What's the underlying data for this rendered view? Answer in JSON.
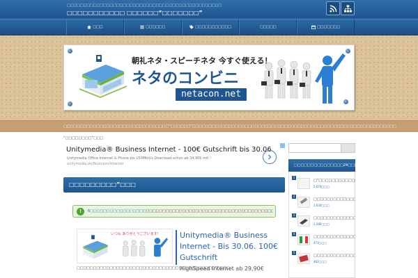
{
  "header": {
    "tagline": "□□□□□□□□□□□□□□□□□□□□□□□□□□□□□□□□□□□□□□□□□□□□□□□",
    "site_title": "□□□□□□□□□□□ □□□□□□“□□□□□□□”",
    "buttons": [
      {
        "name": "rss-icon"
      },
      {
        "name": "sitemap-icon"
      }
    ]
  },
  "nav": {
    "items": [
      {
        "icon": "home-icon",
        "label": "□□□"
      },
      {
        "icon": "list-icon",
        "label": "□□□□□□"
      },
      {
        "icon": "tag-icon",
        "label": "□□□□□□□□□□□"
      },
      {
        "icon": "none",
        "label": "□□□□□"
      },
      {
        "icon": "calendar-icon",
        "label": "□□□□□□□"
      }
    ]
  },
  "banner": {
    "tagline": "朝礼ネタ・スピーチネタ 今すぐ使える！",
    "title": "ネタのコンビニ",
    "domain": "netacon.net"
  },
  "strip": {
    "text": "□□□□□□□□□□□□□□□□□□□□□□□□□□□□□□□□“□□□□□□”□□□□□□□□□□□□□□□□□□□□□□□□□□□□□□□□□□□□□□□□□□□□□□□□□□□□□□□□□□□□□□"
  },
  "breadcrumb": "“□□□□□□□□”□□□",
  "ad1": {
    "title": "Unitymedia® Business Internet - 100€ Gutschrift bis 30.06.",
    "desc": "Unitymedia Office Internet & Phone bis 150Mbit/s Download schon ab 34,90€ mtl.!",
    "url": "unitymedia.de/Business/Internet"
  },
  "post": {
    "title": "□□□□□□□□□”□□□"
  },
  "notice": {
    "icon": "!",
    "link": "6□□□□□□□□□□□□□□□□□",
    "text": "□□□□□□□□□□□□□□□□□□□□□□□□□□□□□□□□□□□□□□□□□□□□□□□□□□□□□□□"
  },
  "thumb": {
    "caption": "いつも ありがとうございます!"
  },
  "ad2": {
    "title": "Unitymedia® Business Internet - Bis 30.06. 100€ Gutschrift",
    "desc": "HighSpeed Internet ab 29,90€"
  },
  "excerpt": "□□□□□□□□□□□□□□□□□□□□□□□□□□□□□□□□□□□□□□□□□□”□□□□",
  "sidebar": {
    "search_placeholder": "",
    "heading": "□□□□□□□□□□□□□□□24□□□",
    "items": [
      {
        "title": "□“□□□□□□□□□□□□□□□□□□",
        "count": "2,674□□□"
      },
      {
        "title": "□□□□□□□□□□□□□□□□□□□",
        "count": "1,620□□□"
      },
      {
        "title": "□□□□□□□□□□□□□□□□□□□",
        "count": "1,580□□□"
      },
      {
        "title": "□□□□□□□□□□□□□□□□□□□",
        "count": "473□□□"
      },
      {
        "title": "□□□□□□□□□□□□□□□□□□□",
        "count": "462□□□"
      }
    ]
  },
  "colors": {
    "accent": "#1f5590",
    "cork": "#dcc39a",
    "strip": "#c79e73",
    "notice_border": "#7cc45a"
  }
}
